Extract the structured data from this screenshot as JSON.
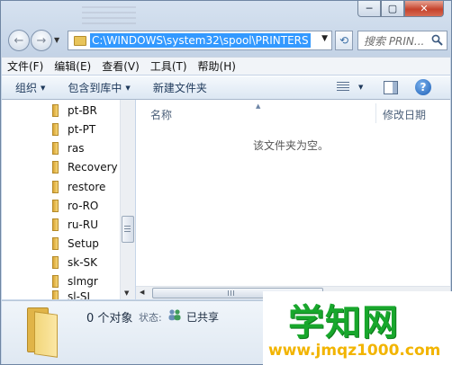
{
  "window": {
    "caption_buttons": [
      {
        "name": "minimize",
        "glyph": "─"
      },
      {
        "name": "maximize",
        "glyph": "▢"
      },
      {
        "name": "close",
        "glyph": "✕"
      }
    ]
  },
  "nav": {
    "back_glyph": "←",
    "forward_glyph": "→",
    "address": "C:\\WINDOWS\\system32\\spool\\PRINTERS",
    "address_dropdown_glyph": "▼",
    "refresh_glyph": "⟲",
    "search_placeholder": "搜索 PRIN..."
  },
  "menu": {
    "items": [
      "文件(F)",
      "编辑(E)",
      "查看(V)",
      "工具(T)",
      "帮助(H)"
    ]
  },
  "toolbar": {
    "organize": "组织",
    "include_in_library": "包含到库中",
    "new_folder": "新建文件夹",
    "help_glyph": "?"
  },
  "tree": {
    "items": [
      "pt-BR",
      "pt-PT",
      "ras",
      "Recovery",
      "restore",
      "ro-RO",
      "ru-RU",
      "Setup",
      "sk-SK",
      "slmgr",
      "sl-SI"
    ]
  },
  "content": {
    "columns": [
      "名称",
      "修改日期"
    ],
    "empty_message": "该文件夹为空。"
  },
  "details": {
    "count": "0 个对象",
    "state_label": "状态:",
    "state_value": "已共享"
  },
  "watermark": {
    "title": "学知网",
    "url": "www.jmqz1000.com"
  }
}
